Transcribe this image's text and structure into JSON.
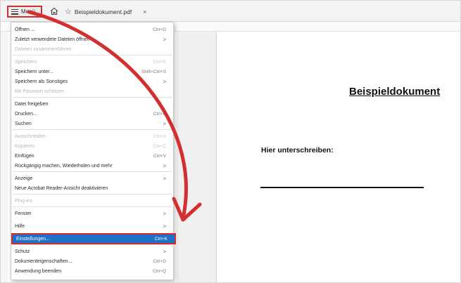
{
  "tabbar": {
    "menu_label": "Menü",
    "tab_title": "Beispieldokument.pdf",
    "tab_close": "×"
  },
  "document": {
    "title": "Beispieldokument",
    "sign_label": "Hier unterschreiben:"
  },
  "menu": {
    "items": [
      {
        "label": "Öffnen ...",
        "shortcut": "Ctrl+O",
        "disabled": false
      },
      {
        "label": "Zuletzt verwendete Dateien öffnen",
        "shortcut": ">",
        "disabled": false
      },
      {
        "label": "Dateien zusammenführen",
        "shortcut": "",
        "disabled": true
      },
      {
        "label": "Speichern",
        "shortcut": "Ctrl+S",
        "disabled": true
      },
      {
        "label": "Speichern unter...",
        "shortcut": "Shift+Ctrl+S",
        "disabled": false
      },
      {
        "label": "Speichern als Sonstiges",
        "shortcut": ">",
        "disabled": false
      },
      {
        "label": "Mit Passwort schützen",
        "shortcut": "",
        "disabled": true
      },
      {
        "label": "Datei freigeben",
        "shortcut": "",
        "disabled": false
      },
      {
        "label": "Drucken...",
        "shortcut": "Ctrl+P",
        "disabled": false
      },
      {
        "label": "Suchen",
        "shortcut": ">",
        "disabled": false
      },
      {
        "label": "Ausschneiden",
        "shortcut": "Ctrl+X",
        "disabled": true
      },
      {
        "label": "Kopieren",
        "shortcut": "Ctrl+C",
        "disabled": true
      },
      {
        "label": "Einfügen",
        "shortcut": "Ctrl+V",
        "disabled": false
      },
      {
        "label": "Rückgängig machen, Wiederholen und mehr",
        "shortcut": ">",
        "disabled": false
      },
      {
        "label": "Anzeige",
        "shortcut": ">",
        "disabled": false
      },
      {
        "label": "Neue Acrobat Reader-Ansicht deaktivieren",
        "shortcut": "",
        "disabled": false
      },
      {
        "label": "Plug-ins",
        "shortcut": "",
        "disabled": true
      },
      {
        "label": "Fenster",
        "shortcut": ">",
        "disabled": false
      },
      {
        "label": "Hilfe",
        "shortcut": ">",
        "disabled": false
      },
      {
        "label": "Einstellungen...",
        "shortcut": "Ctrl+K",
        "disabled": false
      },
      {
        "label": "Schutz",
        "shortcut": ">",
        "disabled": false
      },
      {
        "label": "Dokumenteigenschaften...",
        "shortcut": "Ctrl+D",
        "disabled": false
      },
      {
        "label": "Anwendung beenden",
        "shortcut": "Ctrl+Q",
        "disabled": false
      }
    ]
  },
  "colors": {
    "highlight": "#1d71c8",
    "annotation": "#d32f2f"
  }
}
